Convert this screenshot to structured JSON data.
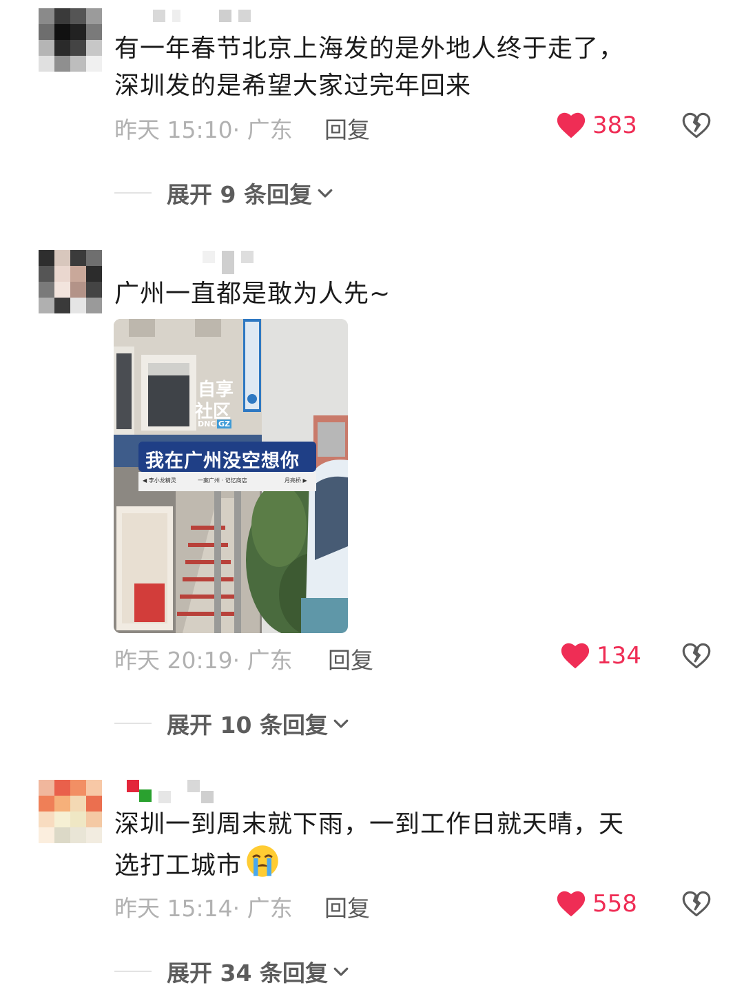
{
  "comments": [
    {
      "text_line1": "有一年春节北京上海发的是外地人终于走了，",
      "text_line2": "深圳发的是希望大家过完年回来",
      "meta": "昨天 15:10· 广东",
      "reply_label": "回复",
      "likes": "383",
      "expand_label": "展开 9 条回复"
    },
    {
      "text_line1": "广州一直都是敢为人先~",
      "has_image": true,
      "photo": {
        "sign_main": "我在广州没空想你",
        "sign_sub_left": "◀ 李小龙精灵",
        "sign_sub_mid": "一案广州 · 记忆商店",
        "sign_sub_right": "月亮桥 ▶",
        "building_sign_1": "自享",
        "building_sign_2": "社区",
        "building_sign_3": "DNC",
        "building_sign_4": "GZ"
      },
      "meta": "昨天 20:19· 广东",
      "reply_label": "回复",
      "likes": "134",
      "expand_label": "展开 10 条回复"
    },
    {
      "text_line1": "深圳一到周末就下雨，一到工作日就天晴，天",
      "text_line2": "选打工城市",
      "emoji": "loudly-crying-face",
      "meta": "昨天 15:14· 广东",
      "reply_label": "回复",
      "likes": "558",
      "expand_label": "展开 34 条回复"
    }
  ],
  "colors": {
    "like_red": "#ef2d55",
    "meta_gray": "#b1b1b1",
    "reply_gray": "#5a5a5a",
    "text": "#1b1b1b"
  }
}
